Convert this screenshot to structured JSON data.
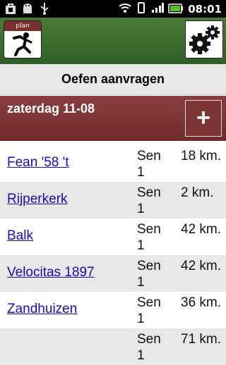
{
  "status_bar": {
    "time": "08:01",
    "icons_left": [
      "bag-icon",
      "android-icon",
      "usb-icon"
    ],
    "icons_right": [
      "wifi-icon",
      "vibrate-icon",
      "signal-icon",
      "battery-icon"
    ]
  },
  "toolbar": {
    "plan_label": "plan",
    "plan_icon": "runner-icon",
    "settings_icon": "gears-icon"
  },
  "title": "Oefen aanvragen",
  "date_header": {
    "label": "zaterdag 11-08",
    "add_label": "+"
  },
  "rows": [
    {
      "club": "Fean '58 't",
      "level": "Sen 1",
      "distance": "18 km."
    },
    {
      "club": "Rijperkerk",
      "level": "Sen 1",
      "distance": "2 km."
    },
    {
      "club": "Balk",
      "level": "Sen 1",
      "distance": "42 km."
    },
    {
      "club": "Velocitas 1897",
      "level": "Sen 1",
      "distance": "42 km."
    },
    {
      "club": "Zandhuizen",
      "level": "Sen 1",
      "distance": "36 km."
    },
    {
      "club": "",
      "level": "Sen 1",
      "distance": "71 km."
    }
  ],
  "colors": {
    "toolbar_green": "#3f6f31",
    "date_header_red": "#7c3535",
    "link_blue": "#1a0dab",
    "alt_row": "#e7e7e7"
  }
}
